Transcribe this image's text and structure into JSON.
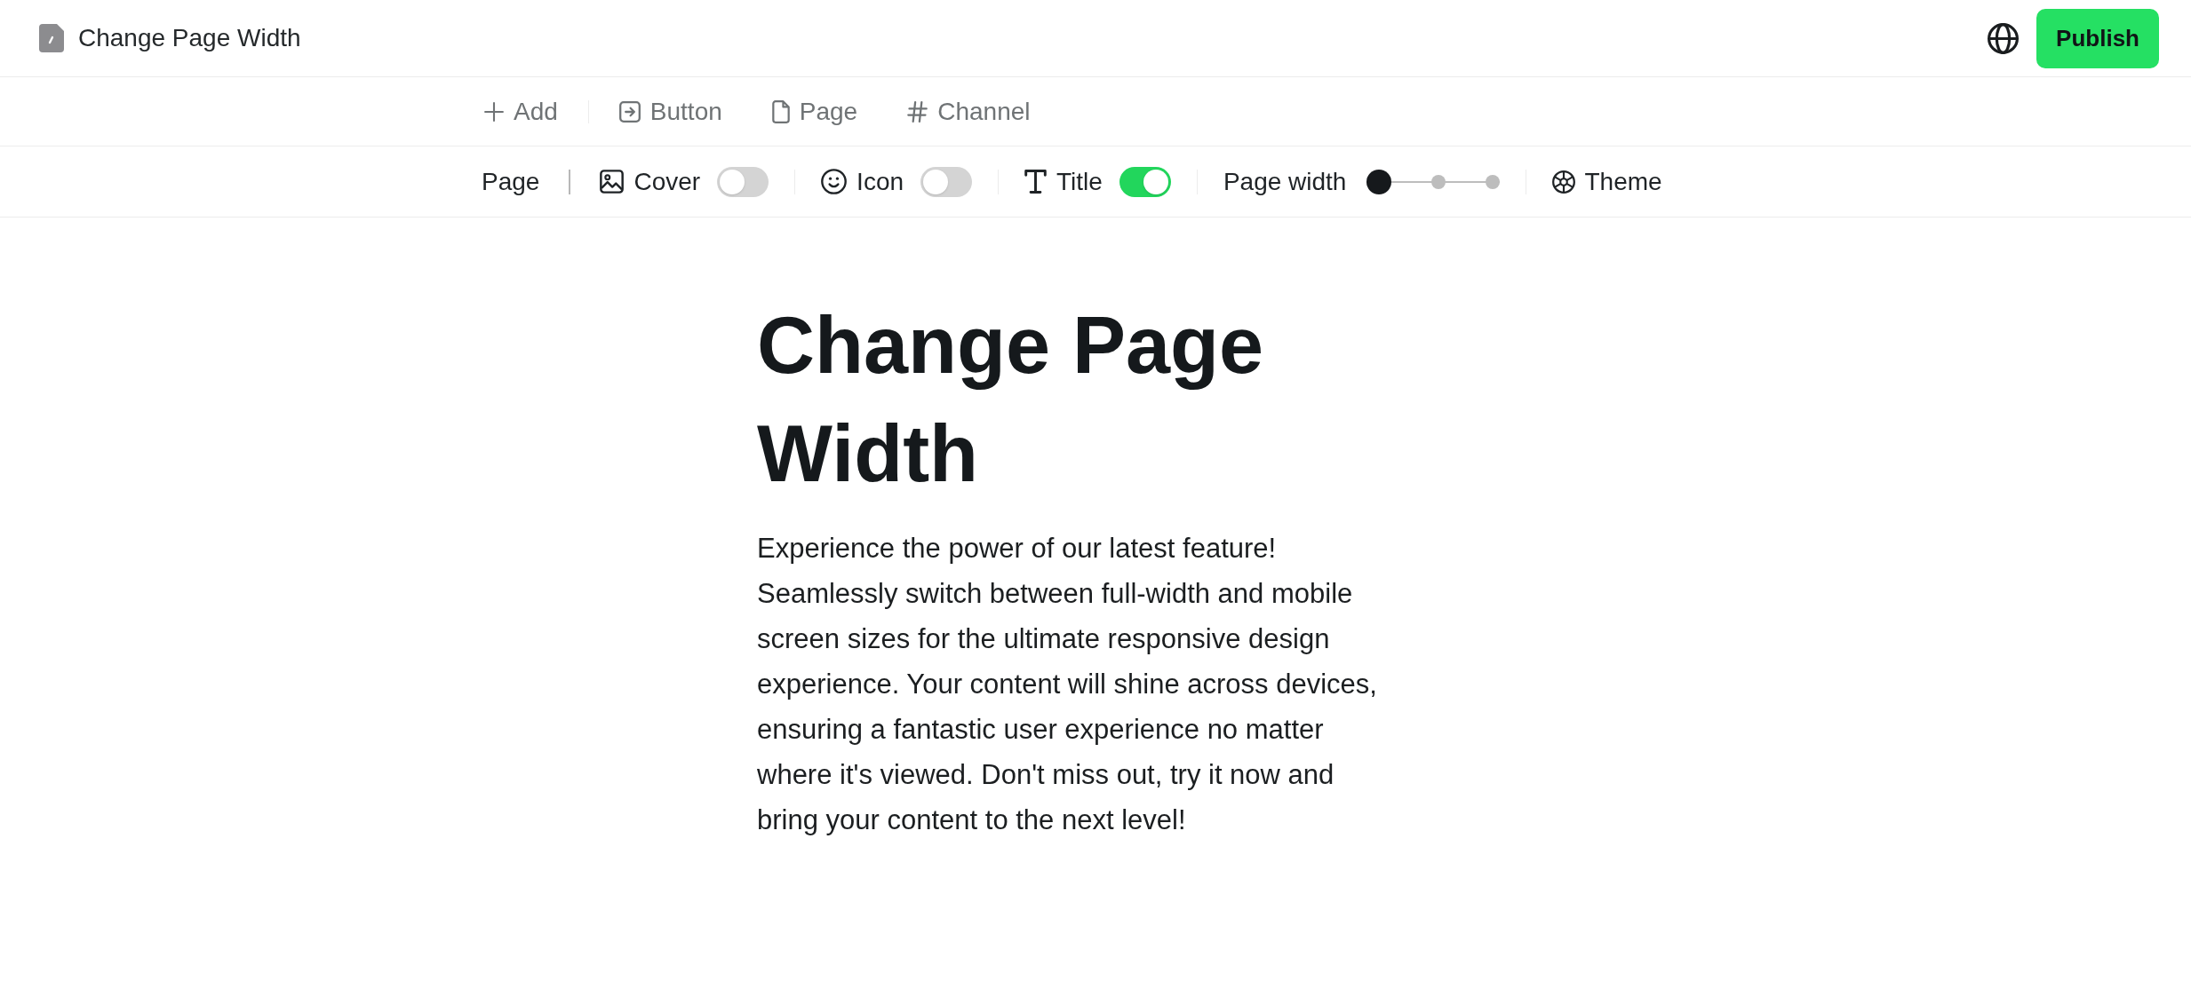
{
  "header": {
    "document_title": "Change Page Width",
    "publish_button": "Publish"
  },
  "insert_toolbar": [
    {
      "label": "Add"
    },
    {
      "label": "Button"
    },
    {
      "label": "Page"
    },
    {
      "label": "Channel"
    }
  ],
  "page_toolbar": {
    "label": "Page",
    "items": [
      {
        "kind": "toggle",
        "label": "Cover",
        "on": false
      },
      {
        "kind": "toggle",
        "label": "Icon",
        "on": false
      },
      {
        "kind": "toggle",
        "label": "Title",
        "on": true
      },
      {
        "kind": "stepper",
        "label": "Page width",
        "steps": [
          {
            "selected": true
          },
          {
            "selected": false
          },
          {
            "selected": false
          }
        ]
      },
      {
        "kind": "button",
        "label": "Theme"
      }
    ]
  },
  "page": {
    "title": "Change Page Width",
    "body": "Experience the power of our latest feature! Seamlessly switch between full-width and mobile screen sizes for the ultimate responsive design experience. Your content will shine across devices, ensuring a fantastic user experience no matter where it's viewed. Don't miss out, try it now and bring your content to the next level!"
  }
}
